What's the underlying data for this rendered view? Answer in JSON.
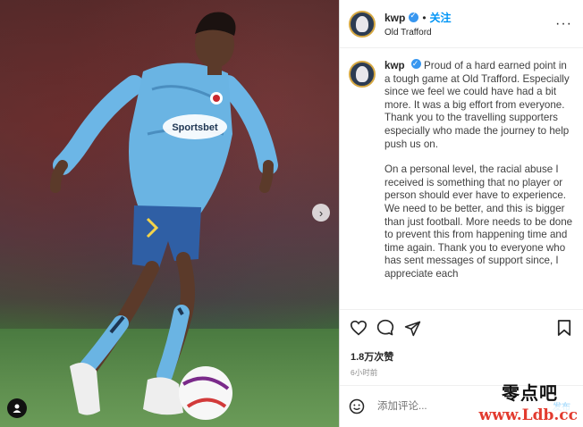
{
  "post": {
    "username": "kwp",
    "separator": "•",
    "follow_label": "关注",
    "location": "Old Trafford",
    "more_label": "···",
    "caption_paragraphs": [
      "Proud of a hard earned point in a tough game at Old Trafford. Especially since we feel we could have had a bit more. It was a big effort from everyone. Thank you to the travelling supporters especially who made the journey to help push us on.",
      "On a personal level, the racial abuse I received is something that no player or person should ever have to experience. We need to be better, and this is bigger than just football. More needs to be done to prevent this from happening time and time again. Thank you to everyone who has sent messages of support since, I appreciate each"
    ],
    "likes": "1.8万次赞",
    "time": "6小时前",
    "comment_placeholder": "添加评论...",
    "publish_label": "发布",
    "carousel_next": "›"
  },
  "media": {
    "jersey_sponsor": "Sportsbet"
  },
  "watermark": {
    "line1": "零点吧",
    "line2": "www.Ldb.cc"
  },
  "colors": {
    "accent": "#0095f6",
    "verified": "#3897f0",
    "text": "#262626",
    "muted": "#8e8e8e",
    "watermark_red": "#e23b2f"
  },
  "icons": [
    "heart-icon",
    "comment-icon",
    "share-icon",
    "bookmark-icon",
    "emoji-icon",
    "tag-user-icon",
    "chevron-right-icon",
    "more-options-icon",
    "verified-icon"
  ]
}
